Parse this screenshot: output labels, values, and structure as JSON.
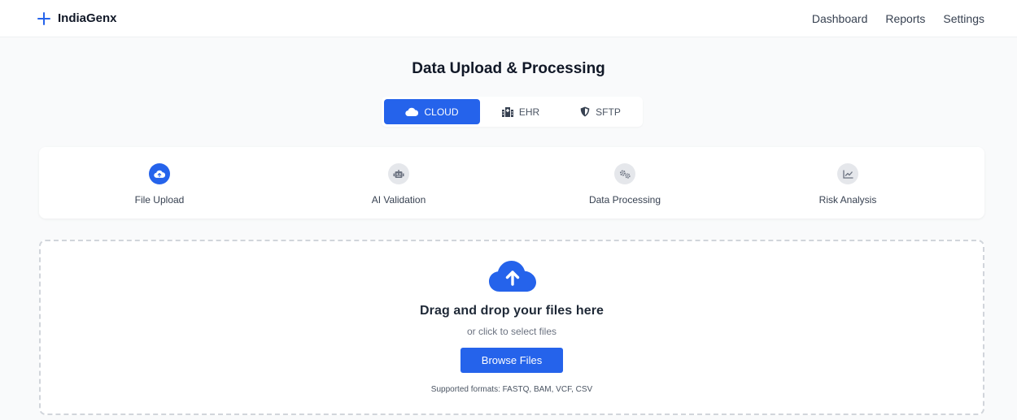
{
  "brand": {
    "name": "IndiaGenx",
    "icon": "plus-icon",
    "color": "#2563eb"
  },
  "nav": {
    "links": [
      "Dashboard",
      "Reports",
      "Settings"
    ]
  },
  "page": {
    "title": "Data Upload & Processing"
  },
  "source_tabs": [
    {
      "label": "CLOUD",
      "icon": "cloud-icon",
      "active": true
    },
    {
      "label": "EHR",
      "icon": "hospital-icon",
      "active": false
    },
    {
      "label": "SFTP",
      "icon": "shield-icon",
      "active": false
    }
  ],
  "steps": [
    {
      "label": "File Upload",
      "icon": "cloud-upload-icon",
      "active": true
    },
    {
      "label": "AI Validation",
      "icon": "robot-icon",
      "active": false
    },
    {
      "label": "Data Processing",
      "icon": "gears-icon",
      "active": false
    },
    {
      "label": "Risk Analysis",
      "icon": "chart-line-icon",
      "active": false
    }
  ],
  "dropzone": {
    "icon": "cloud-upload-icon",
    "title": "Drag and drop your files here",
    "subtitle": "or click to select files",
    "button_label": "Browse Files",
    "formats": "Supported formats: FASTQ, BAM, VCF, CSV"
  },
  "colors": {
    "primary": "#2563eb",
    "inactive_step": "#e5e7eb",
    "background": "#f9fafb"
  }
}
